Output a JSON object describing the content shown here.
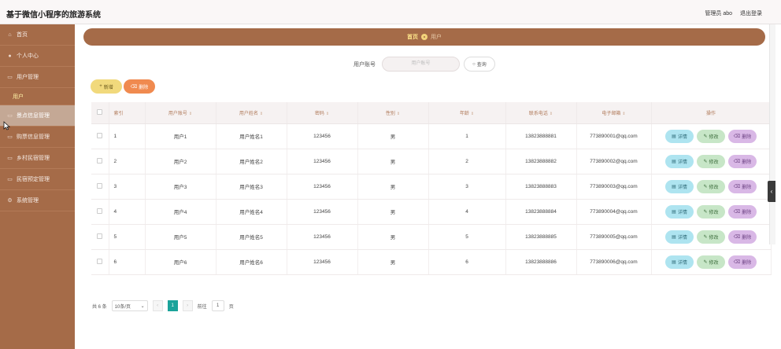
{
  "app": {
    "title": "基于微信小程序的旅游系统"
  },
  "topbar": {
    "admin": "管理员 abo",
    "logout": "退出登录"
  },
  "sidebar": {
    "items": [
      {
        "label": "首页",
        "icon": "home-icon"
      },
      {
        "label": "个人中心",
        "icon": "user-icon"
      },
      {
        "label": "用户管理",
        "icon": "folder-icon",
        "sub": "用户"
      },
      {
        "label": "景点信息管理",
        "icon": "folder-icon"
      },
      {
        "label": "购票信息管理",
        "icon": "folder-icon"
      },
      {
        "label": "乡村民宿管理",
        "icon": "folder-icon"
      },
      {
        "label": "民宿预定管理",
        "icon": "folder-icon"
      },
      {
        "label": "系统管理",
        "icon": "gear-icon"
      }
    ]
  },
  "breadcrumb": {
    "home": "首页",
    "current": "用户"
  },
  "search": {
    "label": "用户账号",
    "placeholder": "用户账号",
    "button": "查询"
  },
  "actions": {
    "add": "新增",
    "delete": "删除"
  },
  "table": {
    "headers": [
      "索引",
      "用户账号",
      "用户姓名",
      "密码",
      "性别",
      "年龄",
      "联系电话",
      "电子邮箱",
      "操作"
    ],
    "rows": [
      {
        "index": "1",
        "account": "用户1",
        "name": "用户姓名1",
        "password": "123456",
        "gender": "男",
        "age": "1",
        "phone": "13823888881",
        "email": "773890001@qq.com"
      },
      {
        "index": "2",
        "account": "用户2",
        "name": "用户姓名2",
        "password": "123456",
        "gender": "男",
        "age": "2",
        "phone": "13823888882",
        "email": "773890002@qq.com"
      },
      {
        "index": "3",
        "account": "用户3",
        "name": "用户姓名3",
        "password": "123456",
        "gender": "男",
        "age": "3",
        "phone": "13823888883",
        "email": "773890003@qq.com"
      },
      {
        "index": "4",
        "account": "用户4",
        "name": "用户姓名4",
        "password": "123456",
        "gender": "男",
        "age": "4",
        "phone": "13823888884",
        "email": "773890004@qq.com"
      },
      {
        "index": "5",
        "account": "用户5",
        "name": "用户姓名5",
        "password": "123456",
        "gender": "男",
        "age": "5",
        "phone": "13823888885",
        "email": "773890005@qq.com"
      },
      {
        "index": "6",
        "account": "用户6",
        "name": "用户姓名6",
        "password": "123456",
        "gender": "男",
        "age": "6",
        "phone": "13823888886",
        "email": "773890006@qq.com"
      }
    ],
    "ops": {
      "detail": "详情",
      "edit": "修改",
      "remove": "删除"
    }
  },
  "pager": {
    "total": "共 6 条",
    "page_size": "10条/页",
    "current_page": "1",
    "goto_label": "前往",
    "goto_value": "1",
    "page_suffix": "页"
  },
  "colors": {
    "sidebar": "#a56b48",
    "accent": "#1aa39a",
    "breadcrumb_text": "#f7e7a0"
  }
}
